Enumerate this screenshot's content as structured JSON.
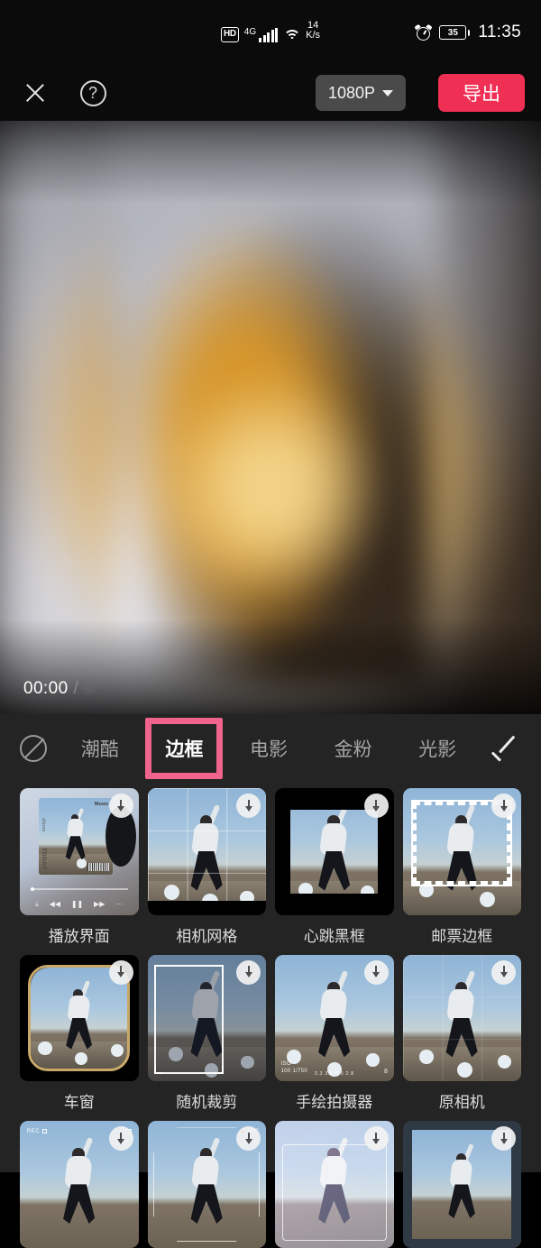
{
  "status_bar": {
    "hd_badge": "HD",
    "network_type": "4G",
    "signal_icon": "signal-bars-icon",
    "wifi_icon": "wifi-icon",
    "speed_value": "14",
    "speed_unit": "K/s",
    "alarm_icon": "alarm-clock-icon",
    "battery_level": "35",
    "time": "11:35"
  },
  "toolbar": {
    "close_icon": "close-icon",
    "help_icon": "question-mark-icon",
    "resolution": "1080P",
    "dropdown_icon": "chevron-down-icon",
    "export_label": "导出",
    "export_color": "#f02f54"
  },
  "player": {
    "current_time": "00:00",
    "separator": "/",
    "total_time": "0"
  },
  "effect_panel": {
    "none_icon": "ban-circle-icon",
    "confirm_icon": "check-icon",
    "highlight_color": "#f0638c",
    "tabs": [
      {
        "label": "潮酷",
        "active": false
      },
      {
        "label": "边框",
        "active": true
      },
      {
        "label": "电影",
        "active": false
      },
      {
        "label": "金粉",
        "active": false
      },
      {
        "label": "光影",
        "active": false
      }
    ],
    "effects": [
      {
        "label": "播放界面",
        "style": "music-player",
        "download_icon": "download-icon"
      },
      {
        "label": "相机网格",
        "style": "camera-grid",
        "download_icon": "download-icon"
      },
      {
        "label": "心跳黑框",
        "style": "heartbeat-black-frame",
        "download_icon": "download-icon"
      },
      {
        "label": "邮票边框",
        "style": "stamp-frame",
        "download_icon": "download-icon"
      },
      {
        "label": "车窗",
        "style": "car-window",
        "download_icon": "download-icon"
      },
      {
        "label": "随机裁剪",
        "style": "random-crop",
        "download_icon": "download-icon"
      },
      {
        "label": "手绘拍摄器",
        "style": "hand-drawn-viewfinder",
        "download_icon": "download-icon"
      },
      {
        "label": "原相机",
        "style": "original-camera",
        "download_icon": "download-icon"
      },
      {
        "label": "",
        "style": "rec-frame",
        "download_icon": "download-icon"
      },
      {
        "label": "",
        "style": "rec-bracket",
        "download_icon": "download-icon"
      },
      {
        "label": "",
        "style": "purple-frame",
        "download_icon": "download-icon"
      },
      {
        "label": "",
        "style": "tablet-frame",
        "download_icon": "download-icon"
      }
    ],
    "viewfinder_labels": {
      "iso": "ISO",
      "iso_value": "100  1/750",
      "aperture_scale": "3.3 3.6 4 5 2.8",
      "counter": "8",
      "rec": "REC",
      "rec_dot": "●"
    }
  }
}
